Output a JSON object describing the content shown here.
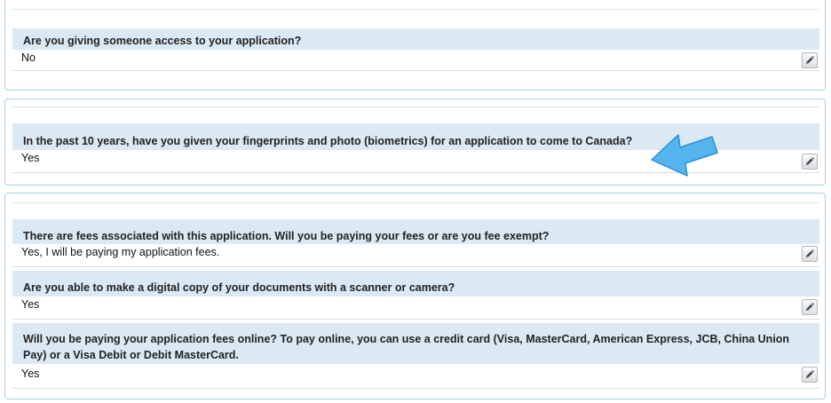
{
  "panels": [
    {
      "items": [
        {
          "question": "Are you giving someone access to your application?",
          "answer": "No",
          "edit_icon": "pencil-icon"
        }
      ]
    },
    {
      "items": [
        {
          "question": "In the past 10 years, have you given your fingerprints and photo (biometrics) for an application to come to Canada?",
          "answer": "Yes",
          "edit_icon": "pencil-icon"
        }
      ]
    },
    {
      "items": [
        {
          "question": "There are fees associated with this application. Will you be paying your fees or are you fee exempt?",
          "answer": "Yes, I will be paying my application fees.",
          "edit_icon": "pencil-icon"
        },
        {
          "question": "Are you able to make a digital copy of your documents with a scanner or camera?",
          "answer": "Yes",
          "edit_icon": "pencil-icon"
        },
        {
          "question": "Will you be paying your application fees online?  To pay online, you can use a credit card (Visa, MasterCard, American Express, JCB, China Union Pay) or a Visa Debit or Debit MasterCard.",
          "answer": "Yes",
          "edit_icon": "pencil-icon"
        }
      ]
    }
  ],
  "annotation": {
    "icon": "arrow-pointer-icon",
    "color": "#55b4f0"
  },
  "colors": {
    "question_bg": "#dbe9f5",
    "panel_border": "#a9cfe0"
  }
}
